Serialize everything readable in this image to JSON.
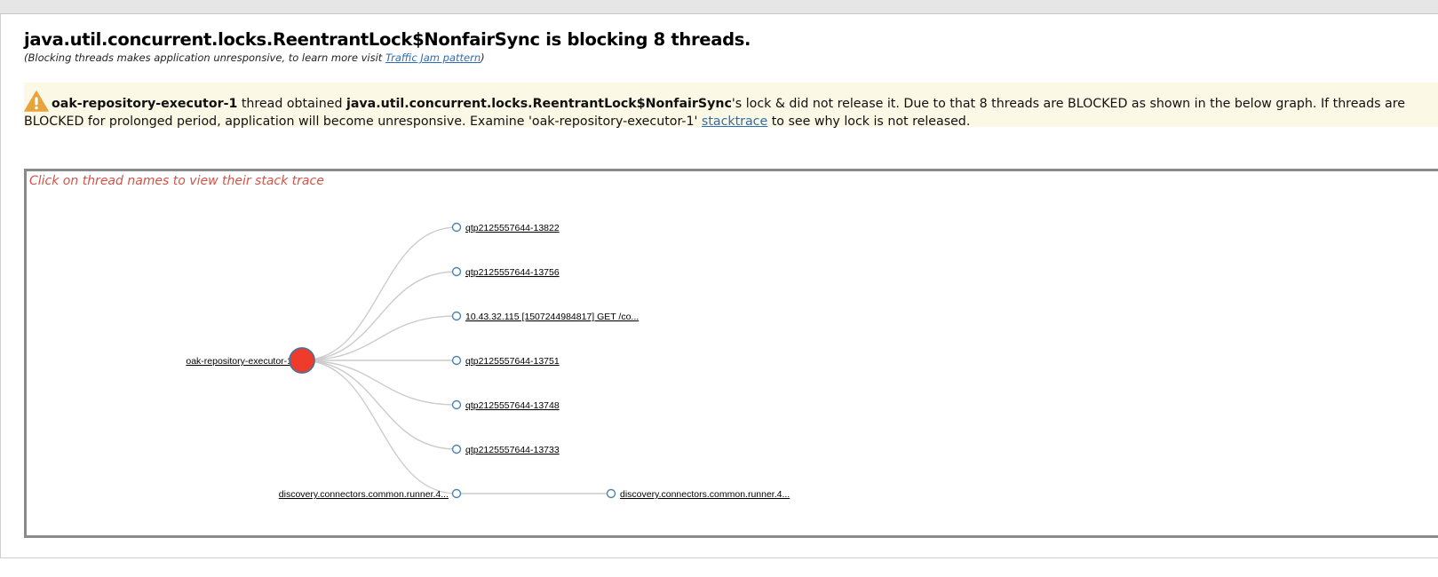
{
  "header": {
    "title": "java.util.concurrent.locks.ReentrantLock$NonfairSync is blocking 8 threads.",
    "subtitle_prefix": "(Blocking threads makes application unresponsive, to learn more visit ",
    "subtitle_link": "Traffic Jam pattern",
    "subtitle_suffix": ")"
  },
  "alert": {
    "icon": "warning-icon",
    "holder_thread": "oak-repository-executor-1",
    "text_1": " thread obtained ",
    "lock_name": "java.util.concurrent.locks.ReentrantLock$NonfairSync",
    "text_2": "'s lock & did not release it. Due to that 8 threads are BLOCKED as shown in the below graph. If threads are BLOCKED for prolonged period, application will become unresponsive. Examine 'oak-repository-executor-1' ",
    "stacktrace_link": "stacktrace",
    "text_3": " to see why lock is not released.",
    "background_color": "#fcf8e6"
  },
  "graph": {
    "hint": "Click on thread names to view their stack trace",
    "root": {
      "label": "oak-repository-executor-1",
      "color": "#ef3b2c"
    },
    "children": [
      {
        "label": "qtp2125557644-13822"
      },
      {
        "label": "qtp2125557644-13756"
      },
      {
        "label": "10.43.32.115 [1507244984817] GET /co..."
      },
      {
        "label": "qtp2125557644-13751"
      },
      {
        "label": "qtp2125557644-13748"
      },
      {
        "label": "qtp2125557644-13733"
      },
      {
        "label": "discovery.connectors.common.runner.4...",
        "children": [
          {
            "label": "discovery.connectors.common.runner.4..."
          }
        ]
      }
    ]
  }
}
